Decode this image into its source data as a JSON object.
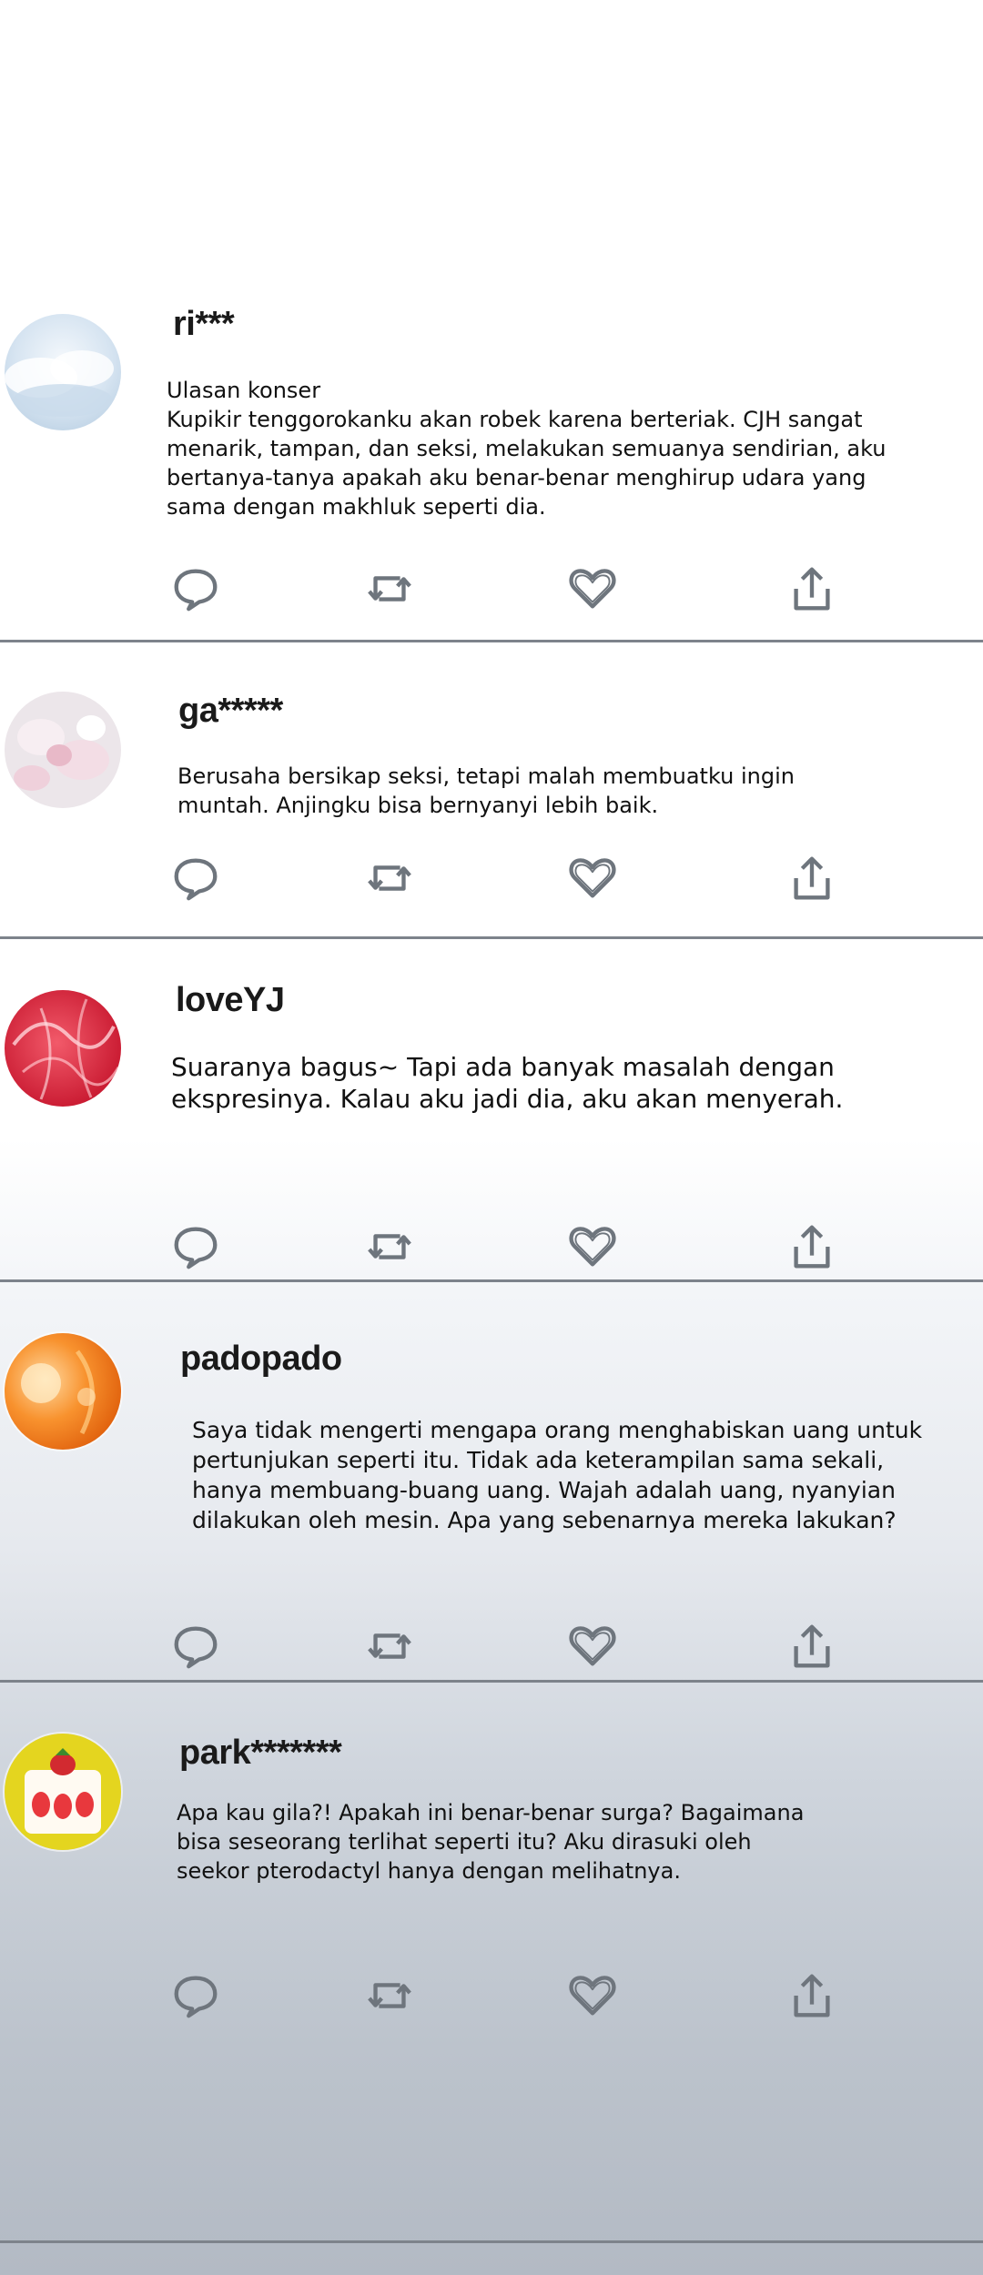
{
  "posts": [
    {
      "username": "ri***",
      "lines": [
        "Ulasan konser",
        "Kupikir tenggorokanku akan robek karena berteriak. CJH sangat",
        "menarik, tampan, dan seksi, melakukan semuanya sendirian, aku",
        "bertanya-tanya apakah aku benar-benar menghirup udara yang",
        "sama dengan makhluk seperti dia."
      ],
      "avatar": "clouds-avatar"
    },
    {
      "username": "ga*****",
      "lines": [
        "Berusaha bersikap seksi, tetapi malah membuatku ingin",
        "muntah. Anjingku bisa bernyanyi lebih baik."
      ],
      "avatar": "flowers-avatar"
    },
    {
      "username": "loveYJ",
      "lines": [
        "Suaranya bagus~ Tapi ada banyak masalah dengan",
        "ekspresinya. Kalau aku jadi dia, aku akan menyerah."
      ],
      "avatar": "red-avatar"
    },
    {
      "username": "padopado",
      "lines": [
        "Saya tidak mengerti mengapa orang menghabiskan uang untuk",
        "pertunjukan seperti itu. Tidak ada keterampilan sama sekali,",
        "hanya membuang-buang uang. Wajah adalah uang, nyanyian",
        "dilakukan oleh mesin. Apa yang sebenarnya mereka lakukan?"
      ],
      "avatar": "orange-avatar"
    },
    {
      "username": "park*******",
      "lines": [
        "Apa kau gila?! Apakah ini benar-benar surga? Bagaimana",
        "bisa seseorang terlihat seperti itu? Aku dirasuki oleh",
        "seekor pterodactyl hanya dengan melihatnya."
      ],
      "avatar": "cake-avatar"
    }
  ],
  "icons": {
    "reply": "speech-bubble-icon",
    "repost": "repost-arrows-icon",
    "like": "heart-icon",
    "share": "share-upload-icon"
  },
  "colors": {
    "icon": "#6e757d",
    "divider": "#7d838b"
  }
}
